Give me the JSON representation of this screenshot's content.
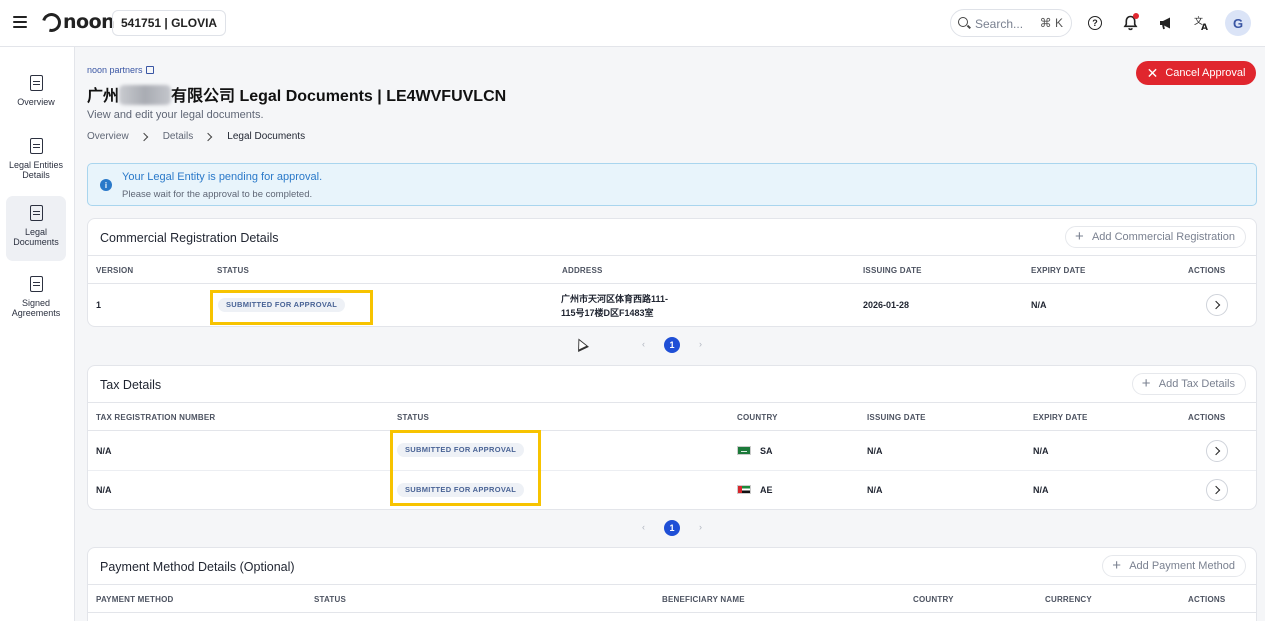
{
  "topbar": {
    "brand": "noon",
    "store": "541751 | GLOVIA",
    "search_placeholder": "Search...",
    "search_shortcut": "⌘ K",
    "avatar_initial": "G"
  },
  "sidebar": {
    "items": [
      {
        "label": "Overview",
        "icon": "clipboard-icon"
      },
      {
        "label": "Legal Entities Details",
        "icon": "document-user-icon"
      },
      {
        "label": "Legal Documents",
        "icon": "documents-icon"
      },
      {
        "label": "Signed Agreements",
        "icon": "signed-document-icon"
      }
    ]
  },
  "header": {
    "partners_link": "noon partners",
    "title_prefix": "广州",
    "title_suffix": "有限公司 Legal Documents | LE4WVFUVLCN",
    "subtitle": "View and edit your legal documents.",
    "cancel_label": "Cancel Approval",
    "breadcrumb": [
      "Overview",
      "Details",
      "Legal Documents"
    ]
  },
  "alert": {
    "title": "Your Legal Entity is pending for approval.",
    "message": "Please wait for the approval to be completed."
  },
  "commercial": {
    "title": "Commercial Registration Details",
    "add_label": "Add Commercial Registration",
    "headers": {
      "version": "VERSION",
      "status": "STATUS",
      "address": "ADDRESS",
      "issuing": "ISSUING DATE",
      "expiry": "EXPIRY DATE",
      "actions": "ACTIONS"
    },
    "rows": [
      {
        "version": "1",
        "status": "SUBMITTED FOR APPROVAL",
        "address_line1": "广州市天河区体育西路111-",
        "address_line2": "115号17楼D区F1483室",
        "issuing": "2026-01-28",
        "expiry": "N/A"
      }
    ],
    "page": "1"
  },
  "tax": {
    "title": "Tax Details",
    "add_label": "Add Tax Details",
    "headers": {
      "trn": "TAX REGISTRATION NUMBER",
      "status": "STATUS",
      "country": "COUNTRY",
      "issuing": "ISSUING DATE",
      "expiry": "EXPIRY DATE",
      "actions": "ACTIONS"
    },
    "rows": [
      {
        "trn": "N/A",
        "status": "SUBMITTED FOR APPROVAL",
        "country": "SA",
        "issuing": "N/A",
        "expiry": "N/A"
      },
      {
        "trn": "N/A",
        "status": "SUBMITTED FOR APPROVAL",
        "country": "AE",
        "issuing": "N/A",
        "expiry": "N/A"
      }
    ],
    "page": "1"
  },
  "payment": {
    "title": "Payment Method Details (Optional)",
    "add_label": "Add Payment Method",
    "headers": {
      "method": "PAYMENT METHOD",
      "status": "STATUS",
      "beneficiary": "BENEFICIARY NAME",
      "country": "COUNTRY",
      "currency": "CURRENCY",
      "actions": "ACTIONS"
    }
  },
  "colors": {
    "accent_red": "#e0262e",
    "highlight": "#f7c300",
    "page_active": "#1f4fd6",
    "info_blue": "#2a79c9"
  }
}
